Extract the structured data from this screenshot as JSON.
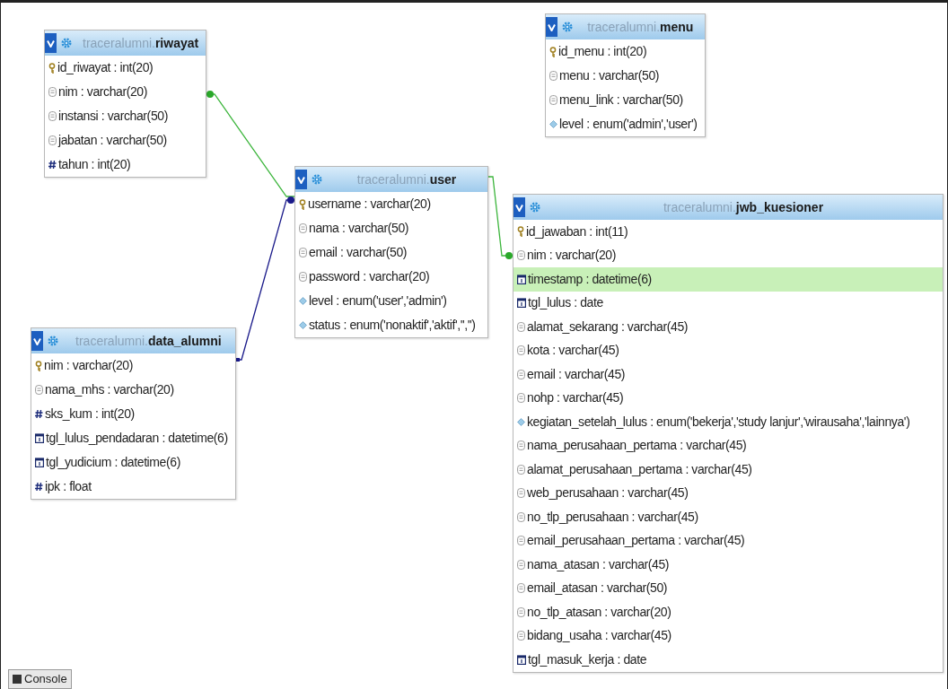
{
  "tables": [
    {
      "title": "traceralumni.**riwayat**",
      "fields": [
        {
          "kind": "key",
          "text": "id_riwayat : int(20)"
        },
        {
          "kind": "text",
          "text": "nim : varchar(20)"
        },
        {
          "kind": "text",
          "text": "instansi : varchar(50)"
        },
        {
          "kind": "text",
          "text": "jabatan : varchar(50)"
        },
        {
          "kind": "number",
          "text": "tahun : int(20)"
        }
      ]
    },
    {
      "title": "traceralumni.**menu**",
      "fields": [
        {
          "kind": "key",
          "text": "id_menu : int(20)"
        },
        {
          "kind": "text",
          "text": "menu : varchar(50)"
        },
        {
          "kind": "text",
          "text": "menu_link : varchar(50)"
        },
        {
          "kind": "enum",
          "text": "level : enum('admin','user')"
        }
      ]
    },
    {
      "title": "traceralumni.**user**",
      "fields": [
        {
          "kind": "key",
          "text": "username : varchar(20)"
        },
        {
          "kind": "text",
          "text": "nama : varchar(50)"
        },
        {
          "kind": "text",
          "text": "email : varchar(50)"
        },
        {
          "kind": "text",
          "text": "password : varchar(20)"
        },
        {
          "kind": "enum",
          "text": "level : enum('user','admin')"
        },
        {
          "kind": "enum",
          "text": "status : enum('nonaktif','aktif','','')"
        }
      ]
    },
    {
      "title": "traceralumni.**data_alumni**",
      "fields": [
        {
          "kind": "key",
          "text": "nim : varchar(20)"
        },
        {
          "kind": "text",
          "text": "nama_mhs : varchar(20)"
        },
        {
          "kind": "number",
          "text": "sks_kum : int(20)"
        },
        {
          "kind": "date",
          "text": "tgl_lulus_pendadaran : datetime(6)"
        },
        {
          "kind": "date",
          "text": "tgl_yudicium : datetime(6)"
        },
        {
          "kind": "number",
          "text": "ipk : float"
        }
      ]
    },
    {
      "title": "traceralumni.**jwb_kuesioner**",
      "fields": [
        {
          "kind": "key",
          "text": "id_jawaban : int(11)",
          "highlighted": false
        },
        {
          "kind": "text",
          "text": "nim : varchar(20)",
          "highlighted": false
        },
        {
          "kind": "date",
          "text": "timestamp : datetime(6)",
          "highlighted": true
        },
        {
          "kind": "date",
          "text": "tgl_lulus : date",
          "highlighted": false
        },
        {
          "kind": "text",
          "text": "alamat_sekarang : varchar(45)",
          "highlighted": false
        },
        {
          "kind": "text",
          "text": "kota : varchar(45)",
          "highlighted": false
        },
        {
          "kind": "text",
          "text": "email : varchar(45)",
          "highlighted": false
        },
        {
          "kind": "text",
          "text": "nohp : varchar(45)",
          "highlighted": false
        },
        {
          "kind": "enum",
          "text": "kegiatan_setelah_lulus : enum('bekerja','study lanjur','wirausaha','lainnya')",
          "highlighted": false
        },
        {
          "kind": "text",
          "text": "nama_perusahaan_pertama : varchar(45)",
          "highlighted": false
        },
        {
          "kind": "text",
          "text": "alamat_perusahaan_pertama : varchar(45)",
          "highlighted": false
        },
        {
          "kind": "text",
          "text": "web_perusahaan : varchar(45)",
          "highlighted": false
        },
        {
          "kind": "text",
          "text": "no_tlp_perusahaan : varchar(45)",
          "highlighted": false
        },
        {
          "kind": "text",
          "text": "email_perusahaan_pertama : varchar(45)",
          "highlighted": false
        },
        {
          "kind": "text",
          "text": "nama_atasan : varchar(45)",
          "highlighted": false
        },
        {
          "kind": "text",
          "text": "email_atasan : varchar(50)",
          "highlighted": false
        },
        {
          "kind": "text",
          "text": "no_tlp_atasan : varchar(20)",
          "highlighted": false
        },
        {
          "kind": "text",
          "text": "bidang_usaha : varchar(45)",
          "highlighted": false
        },
        {
          "kind": "date",
          "text": "tgl_masuk_kerja : date",
          "highlighted": false
        }
      ]
    }
  ],
  "console_button": {
    "label": "Console"
  }
}
